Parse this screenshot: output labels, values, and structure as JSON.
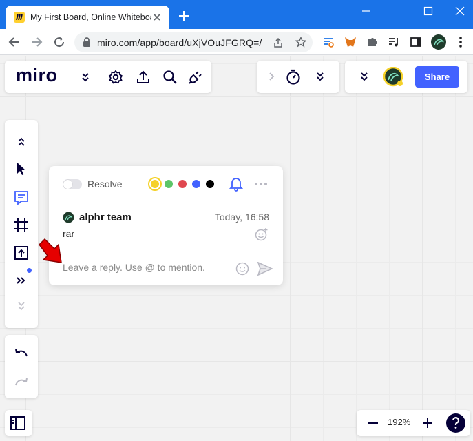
{
  "browser": {
    "tab_title": "My First Board, Online Whiteboar",
    "url": "miro.com/app/board/uXjVOuJFGRQ=/"
  },
  "miro": {
    "logo_text": "miro",
    "share_label": "Share"
  },
  "comment": {
    "resolve_label": "Resolve",
    "colors": [
      "#f5d128",
      "#5cc568",
      "#e0474f",
      "#4262ff",
      "#000000"
    ],
    "author": "alphr team",
    "timestamp": "Today, 16:58",
    "message": "rar",
    "reply_placeholder": "Leave a reply. Use @ to mention."
  },
  "zoom": {
    "level": "192%"
  },
  "colors": {
    "chrome_blue": "#1a73e8",
    "miro_blue": "#4262ff",
    "annotation_red": "#e60000"
  }
}
